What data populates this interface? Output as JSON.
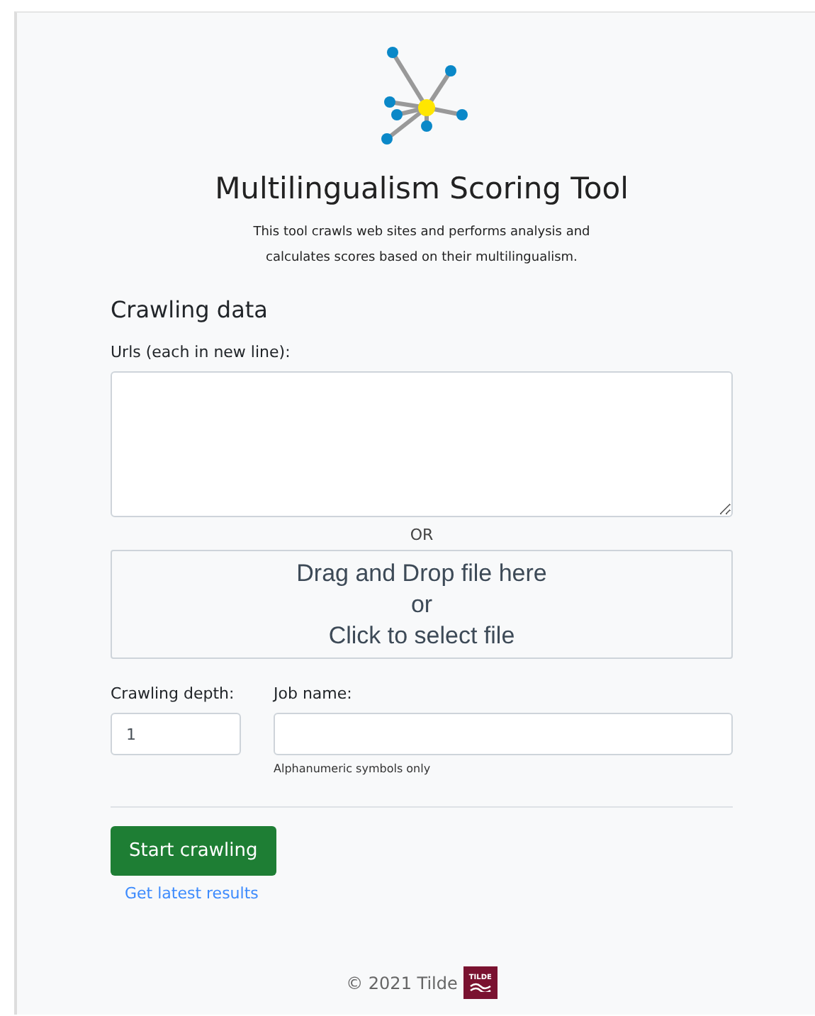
{
  "header": {
    "title": "Multilingualism Scoring Tool",
    "description": [
      "This tool crawls web sites and performs analysis and",
      "calculates scores based on their multilingualism."
    ]
  },
  "form": {
    "heading": "Crawling data",
    "urls_label": "Urls (each in new line):",
    "separator": "OR",
    "dropzone": [
      "Drag and Drop file here",
      "or",
      "Click to select file"
    ],
    "depth": {
      "label": "Crawling depth:",
      "value": "1"
    },
    "job": {
      "label": "Job name:",
      "help": "Alphanumeric symbols only"
    },
    "submit": "Start crawling",
    "link": "Get latest results"
  },
  "footer": {
    "text": "© 2021 Tilde",
    "logo_text": "TILDE"
  }
}
